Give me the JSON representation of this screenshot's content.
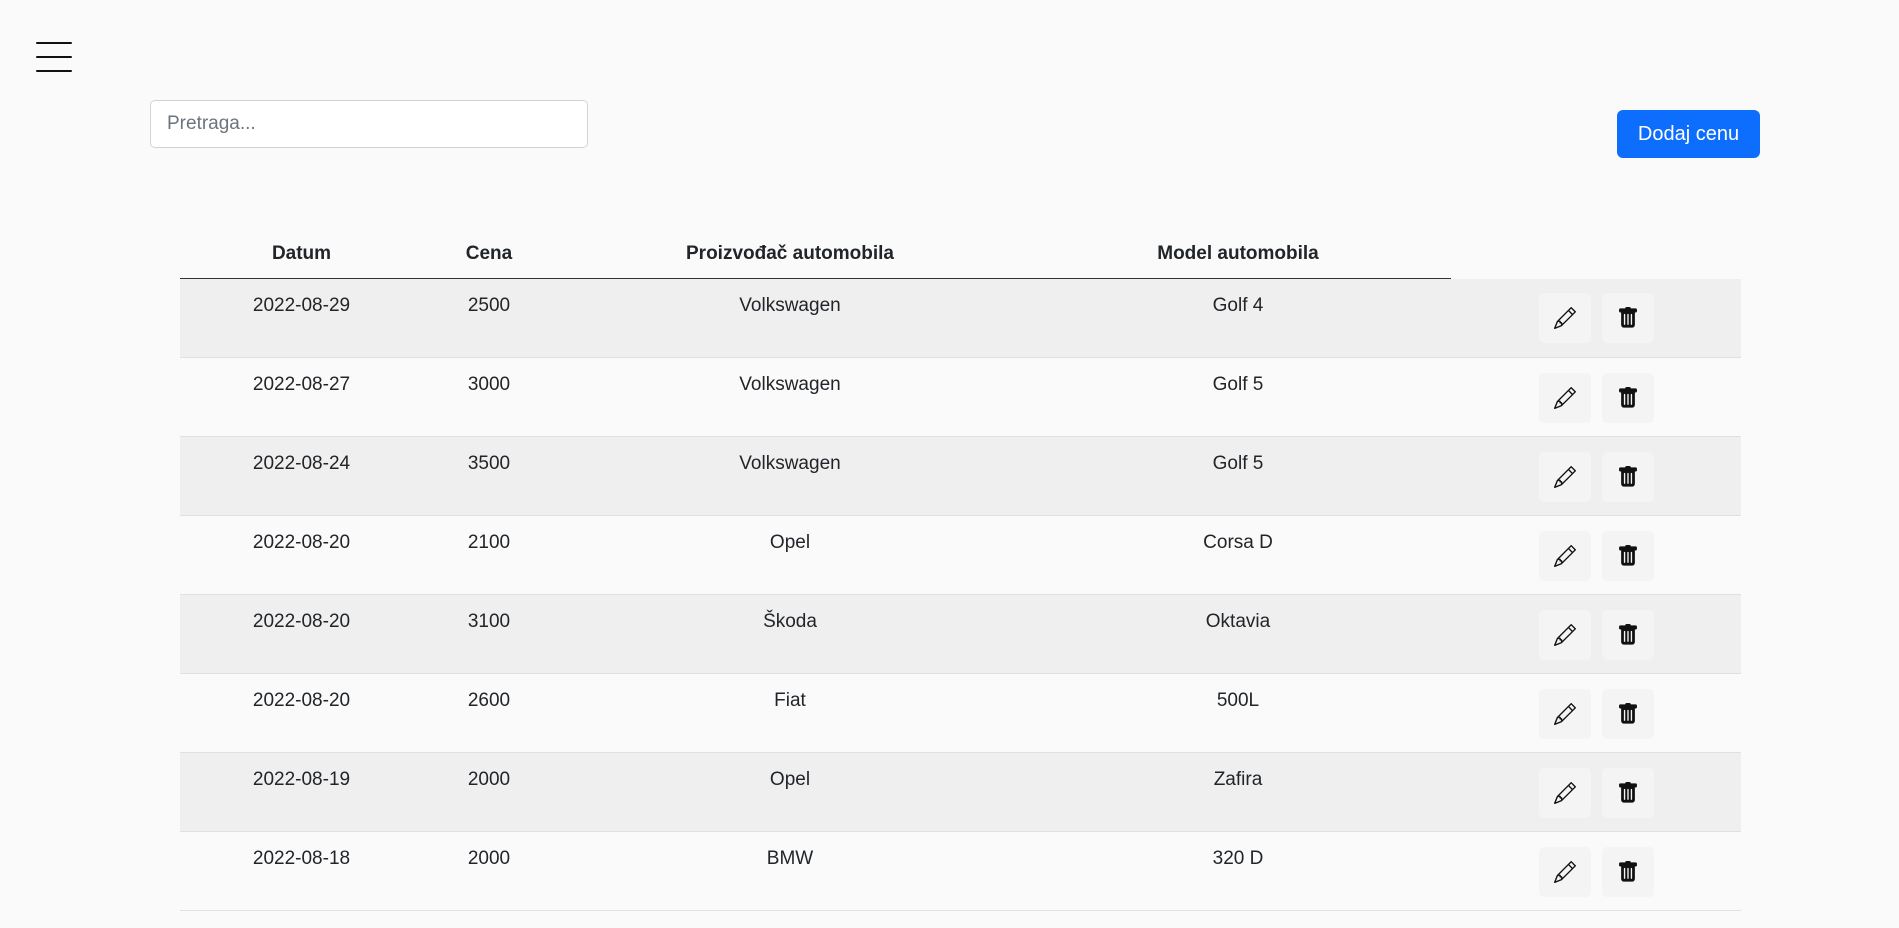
{
  "menu": {
    "icon": "hamburger-menu-icon"
  },
  "search": {
    "placeholder": "Pretraga..."
  },
  "toolbar": {
    "add_label": "Dodaj cenu",
    "add_color": "#0d6efd"
  },
  "table": {
    "columns": [
      "Datum",
      "Cena",
      "Proizvođač automobila",
      "Model automobila"
    ],
    "rows": [
      {
        "date": "2022-08-29",
        "price": "2500",
        "make": "Volkswagen",
        "model": "Golf 4"
      },
      {
        "date": "2022-08-27",
        "price": "3000",
        "make": "Volkswagen",
        "model": "Golf 5"
      },
      {
        "date": "2022-08-24",
        "price": "3500",
        "make": "Volkswagen",
        "model": "Golf 5"
      },
      {
        "date": "2022-08-20",
        "price": "2100",
        "make": "Opel",
        "model": "Corsa D"
      },
      {
        "date": "2022-08-20",
        "price": "3100",
        "make": "Škoda",
        "model": "Oktavia"
      },
      {
        "date": "2022-08-20",
        "price": "2600",
        "make": "Fiat",
        "model": "500L"
      },
      {
        "date": "2022-08-19",
        "price": "2000",
        "make": "Opel",
        "model": "Zafira"
      },
      {
        "date": "2022-08-18",
        "price": "2000",
        "make": "BMW",
        "model": "320 D"
      }
    ],
    "row_actions": [
      {
        "name": "edit",
        "icon": "pencil-icon"
      },
      {
        "name": "delete",
        "icon": "trash-icon"
      }
    ]
  }
}
